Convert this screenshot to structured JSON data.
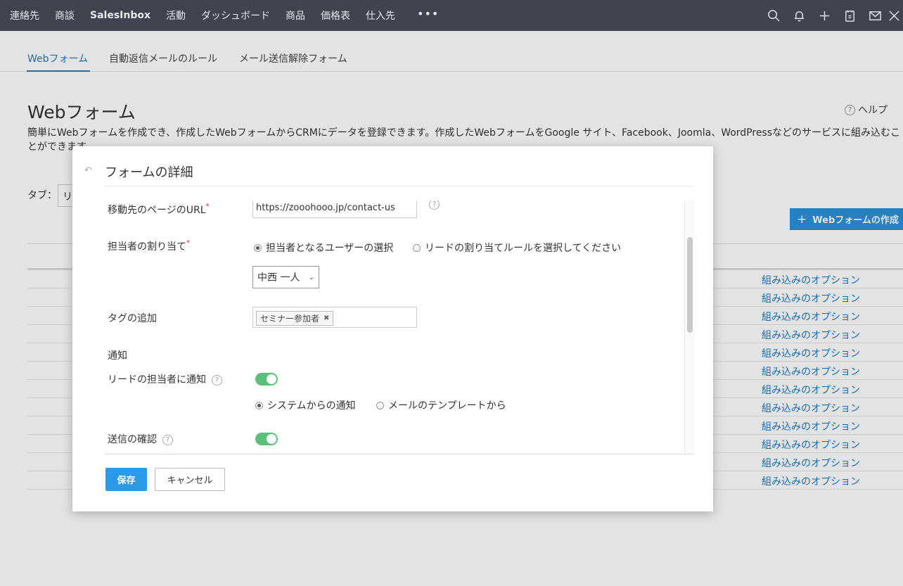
{
  "topnav": {
    "items": [
      "連絡先",
      "商談",
      "SalesInbox",
      "活動",
      "ダッシュボード",
      "商品",
      "価格表",
      "仕入先"
    ],
    "more": "•••",
    "icons": [
      "search-icon",
      "bell-icon",
      "plus-icon",
      "calendar-icon",
      "mail-icon",
      "settings-icon"
    ]
  },
  "subtabs": [
    "Webフォーム",
    "自動返信メールのルール",
    "メール送信解除フォーム"
  ],
  "page": {
    "title": "Webフォーム",
    "help": "ヘルプ",
    "description_line1": "簡単にWebフォームを作成でき、作成したWebフォームからCRMにデータを登録できます。作成したWebフォームをGoogle サイト、Facebook、Joomla、WordPressなどのサービスに組み込むこ",
    "description_line2": "とができます。",
    "tag_label": "タブ：",
    "tag_select_value": "リ",
    "create_button": "Webフォームの作成",
    "embed_option": "組み込みのオプション",
    "embed_rows": 12
  },
  "modal": {
    "back_icon": "undo-icon",
    "title": "フォームの詳細",
    "url_label": "移動先のページのURL",
    "url_value": "https://zooohooo.jp/contact-us",
    "required_mark": "*",
    "owner_label": "担当者の割り当て",
    "owner_option_user": "担当者となるユーザーの選択",
    "owner_option_rule": "リードの割り当てルールを選択してください",
    "owner_selected": "user",
    "owner_user": "中西 一人",
    "tags_label": "タグの追加",
    "tag_chip": "セミナー参加者",
    "notify_section": "通知",
    "notify_owner_label": "リードの担当者に通知",
    "notify_owner_on": true,
    "notify_option_system": "システムからの通知",
    "notify_option_template": "メールのテンプレートから",
    "notify_selected": "system",
    "confirm_label": "送信の確認",
    "confirm_on": true,
    "save": "保存",
    "cancel": "キャンセル"
  }
}
